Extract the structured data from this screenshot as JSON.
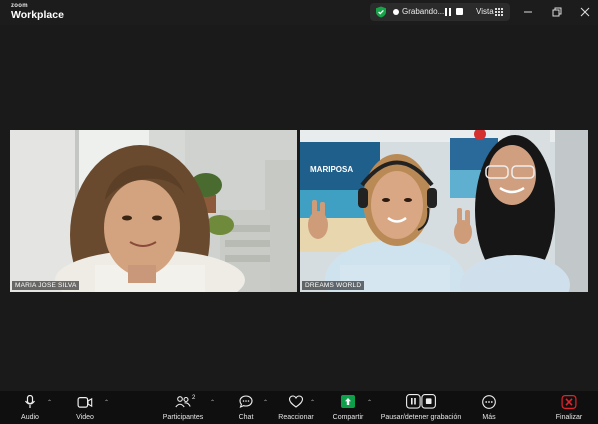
{
  "app": {
    "brand_small": "zoom",
    "brand_name": "Workplace"
  },
  "recording": {
    "status_label": "Grabando...",
    "view_label": "Vista"
  },
  "window_controls": [
    "minimize-icon",
    "restore-icon",
    "close-icon"
  ],
  "participants": [
    {
      "name": "MARIA JOSE SILVA"
    },
    {
      "name": "DREAMS WORLD"
    }
  ],
  "toolbar": {
    "audio_label": "Audio",
    "video_label": "Video",
    "participants_label": "Participantes",
    "participants_count": "2",
    "chat_label": "Chat",
    "react_label": "Reaccionar",
    "share_label": "Compartir",
    "record_label": "Pausar/detener grabación",
    "more_label": "Más",
    "end_label": "Finalizar"
  },
  "colors": {
    "background": "#1c1c1c",
    "toolbar": "#0f0f0f",
    "share_green": "#0e9f4a",
    "end_red": "#e0242e",
    "shield_green": "#17a34a"
  },
  "signs": {
    "back_sign_text": "MARIPOSA",
    "side_sign_text": ""
  }
}
